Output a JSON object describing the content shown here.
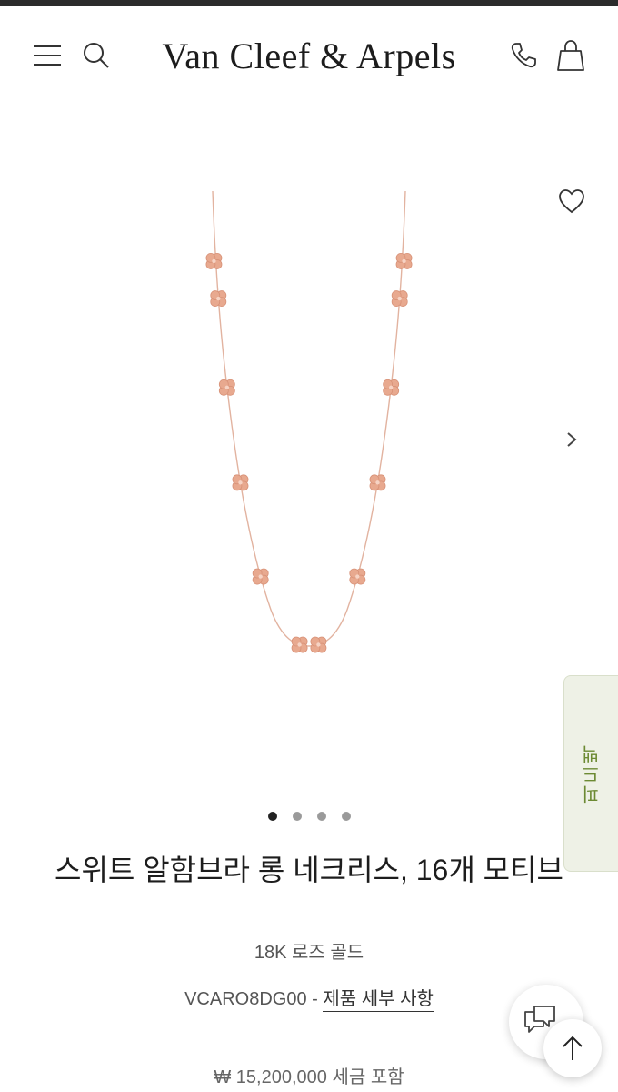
{
  "header": {
    "brand": "Van Cleef & Arpels",
    "icons": [
      "menu-icon",
      "search-icon",
      "phone-icon",
      "shopping-bag-icon"
    ]
  },
  "gallery": {
    "icons": [
      "heart-icon",
      "chevron-right-icon"
    ],
    "slide_count": 4,
    "active_slide": 1
  },
  "feedback_tab": {
    "label": "피드백"
  },
  "product": {
    "title": "스위트 알함브라 롱 네크리스, 16개 모티브",
    "material": "18K 로즈 골드",
    "reference": "VCARO8DG00",
    "separator": " - ",
    "details_link": "제품 세부 사항",
    "price": "₩ 15,200,000 세금 포함"
  },
  "floating": {
    "icons": [
      "chat-icon",
      "arrow-up-icon"
    ]
  },
  "colors": {
    "accent_green": "#6c8a33",
    "feedback_bg": "#eef1e6",
    "rose_gold": "#e8a98f",
    "text_dark": "#1d1d1d"
  }
}
